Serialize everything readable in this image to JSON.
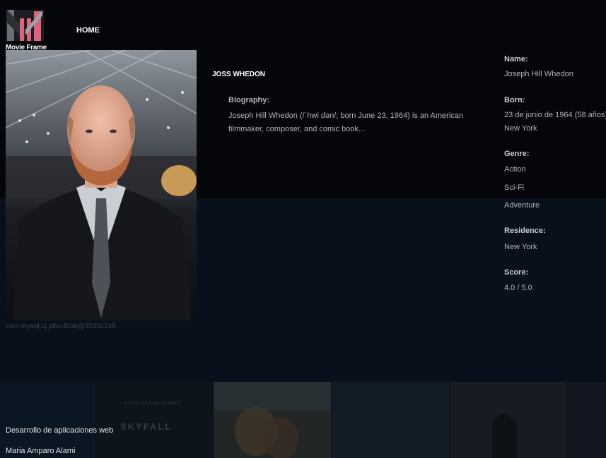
{
  "header": {
    "logo_text": "Movie Frame",
    "nav": {
      "home_label": "HOME"
    }
  },
  "person": {
    "name_heading": "JOSS WHEDON",
    "photo_caption": "com.mysql.cj.jdbc.Blob@2030c249",
    "biography_label": "Biography:",
    "biography_text": "Joseph Hill Whedon (/ˈhwiːdən/; born June 23, 1964) is an American filmmaker, composer, and comic book..."
  },
  "details": {
    "name_label": "Name:",
    "name_value": "Joseph Hill Whedon",
    "born_label": "Born:",
    "born_date": "23 de junio de 1964 (58 años)",
    "born_place": "New York",
    "genre_label": "Genre:",
    "genres": [
      "Action",
      "Sci-Fi",
      "Adventure"
    ],
    "residence_label": "Residence:",
    "residence_value": "New York",
    "score_label": "Score:",
    "score_value": "4.0 / 5.0"
  },
  "footer": {
    "line1": "Desarrollo de aplicaciones web",
    "line2": "Maria Amparo Alami",
    "poster_skyfall_title": "SKYFALL",
    "poster_skyfall_tagline": "A FILM BY SAM MENDES"
  },
  "colors": {
    "background_top": "#050609",
    "background_mid": "#08111b",
    "logo_pink": "#e06478",
    "text_muted": "#aeb4bd"
  }
}
